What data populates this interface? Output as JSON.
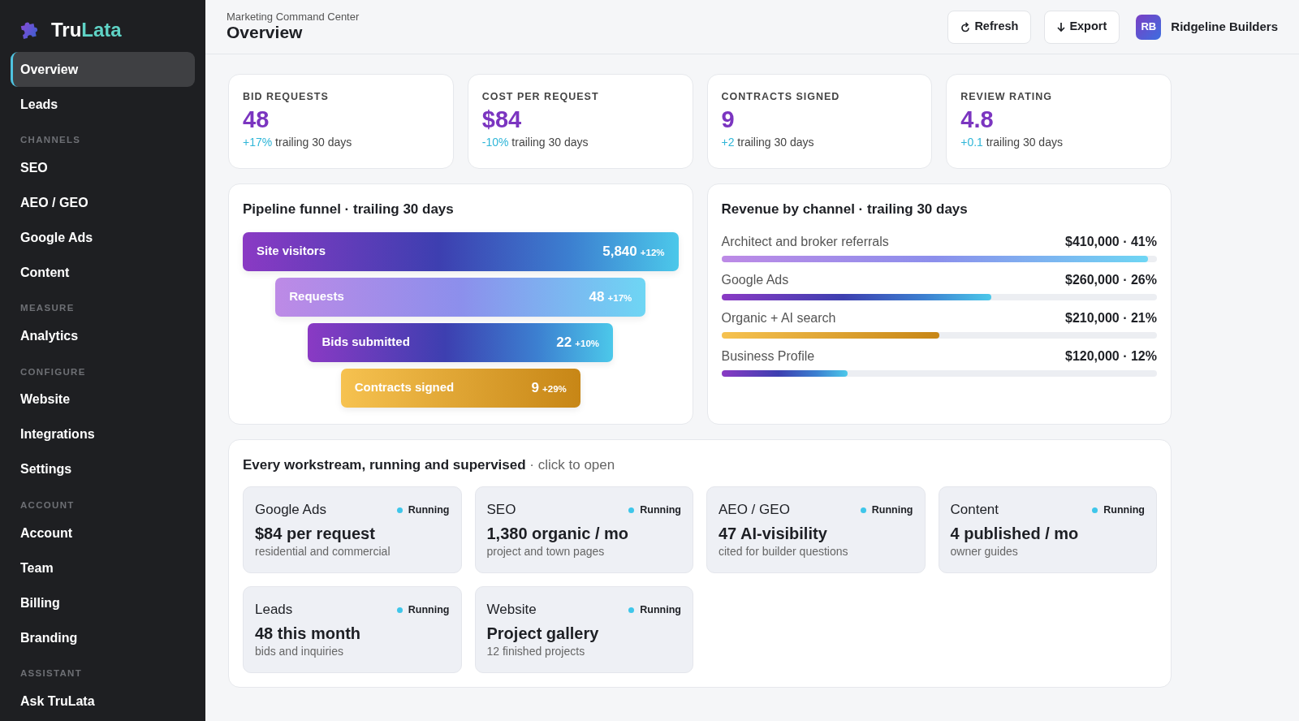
{
  "brand": {
    "name_part1": "Tru",
    "name_part2": "Lata"
  },
  "sidebar": {
    "sections": [
      {
        "items": [
          {
            "label": "Overview",
            "selected": true
          },
          {
            "label": "Leads",
            "selected": false
          }
        ]
      },
      {
        "heading": "CHANNELS",
        "items": [
          {
            "label": "SEO",
            "selected": false
          },
          {
            "label": "AEO / GEO",
            "selected": false
          },
          {
            "label": "Google Ads",
            "selected": false
          },
          {
            "label": "Content",
            "selected": false
          }
        ]
      },
      {
        "heading": "MEASURE",
        "items": [
          {
            "label": "Analytics",
            "selected": false
          }
        ]
      },
      {
        "heading": "CONFIGURE",
        "items": [
          {
            "label": "Website",
            "selected": false
          },
          {
            "label": "Integrations",
            "selected": false
          },
          {
            "label": "Settings",
            "selected": false
          }
        ]
      },
      {
        "heading": "ACCOUNT",
        "items": [
          {
            "label": "Account",
            "selected": false
          },
          {
            "label": "Team",
            "selected": false
          },
          {
            "label": "Billing",
            "selected": false
          },
          {
            "label": "Branding",
            "selected": false
          }
        ]
      },
      {
        "heading": "ASSISTANT",
        "items": [
          {
            "label": "Ask TruLata",
            "selected": false
          }
        ]
      }
    ]
  },
  "header": {
    "subtitle": "Marketing Command Center",
    "title": "Overview",
    "buttons": [
      {
        "kind": "refresh",
        "label": "Refresh"
      },
      {
        "kind": "export",
        "label": "Export"
      }
    ],
    "account": {
      "initials": "RB",
      "name": "Ridgeline Builders"
    }
  },
  "kpis": [
    {
      "label": "BID REQUESTS",
      "value": "48",
      "delta": "+17%",
      "note": "trailing 30 days"
    },
    {
      "label": "COST PER REQUEST",
      "value": "$84",
      "delta": "-10%",
      "note": "trailing 30 days"
    },
    {
      "label": "CONTRACTS SIGNED",
      "value": "9",
      "delta": "+2",
      "note": "trailing 30 days"
    },
    {
      "label": "REVIEW RATING",
      "value": "4.8",
      "delta": "+0.1",
      "note": "trailing 30 days"
    }
  ],
  "funnel": {
    "title": "Pipeline funnel · trailing 30 days",
    "stages": [
      {
        "label": "Site visitors",
        "value": "5,840",
        "change": "+12%",
        "kind": "vivid"
      },
      {
        "label": "Requests",
        "value": "48",
        "change": "+17%",
        "kind": "pastel"
      },
      {
        "label": "Bids submitted",
        "value": "22",
        "change": "+10%",
        "kind": "vivid"
      },
      {
        "label": "Contracts signed",
        "value": "9",
        "change": "+29%",
        "kind": "gold"
      }
    ]
  },
  "revenue": {
    "title": "Revenue by channel · trailing 30 days",
    "channels": [
      {
        "name": "Architect and broker referrals",
        "amount": "$410,000 · 41%",
        "level": 0.98,
        "kind": "pastel"
      },
      {
        "name": "Google Ads",
        "amount": "$260,000 · 26%",
        "level": 0.62,
        "kind": "vivid"
      },
      {
        "name": "Organic + AI search",
        "amount": "$210,000 · 21%",
        "level": 0.5,
        "kind": "gold"
      },
      {
        "name": "Business Profile",
        "amount": "$120,000 · 12%",
        "level": 0.29,
        "kind": "vivid"
      }
    ]
  },
  "workstreams": {
    "title": "Every workstream, running and supervised",
    "hint": "· click to open",
    "items": [
      {
        "name": "Google Ads",
        "status": "Running",
        "headline": "$84 per request",
        "detail": "residential and commercial"
      },
      {
        "name": "SEO",
        "status": "Running",
        "headline": "1,380 organic / mo",
        "detail": "project and town pages"
      },
      {
        "name": "AEO / GEO",
        "status": "Running",
        "headline": "47 AI-visibility",
        "detail": "cited for builder questions"
      },
      {
        "name": "Content",
        "status": "Running",
        "headline": "4 published / mo",
        "detail": "owner guides"
      },
      {
        "name": "Leads",
        "status": "Running",
        "headline": "48 this month",
        "detail": "bids and inquiries"
      },
      {
        "name": "Website",
        "status": "Running",
        "headline": "Project gallery",
        "detail": "12 finished projects"
      }
    ]
  }
}
